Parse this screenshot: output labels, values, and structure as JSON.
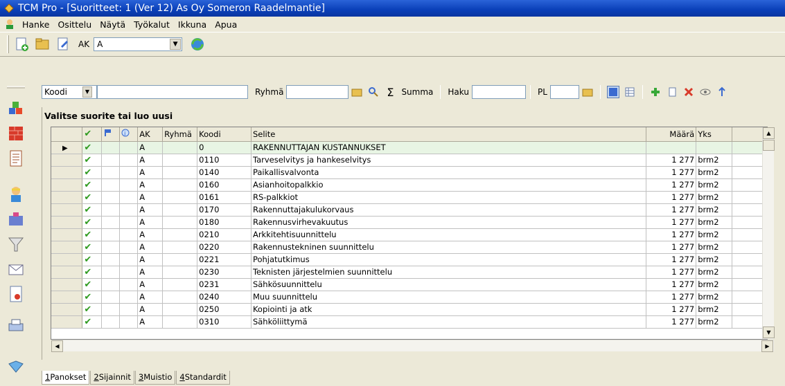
{
  "window": {
    "title": "TCM Pro - [Suoritteet: 1 (Ver 12) As Oy Someron Raadelmantie]"
  },
  "menu": [
    "Hanke",
    "Osittelu",
    "Näytä",
    "Työkalut",
    "Ikkuna",
    "Apua"
  ],
  "toolbar": {
    "ak_label": "AK",
    "ak_value": "A"
  },
  "filterbar": {
    "field_combo": "Koodi",
    "group_label": "Ryhmä",
    "sum_label": "Summa",
    "search_label": "Haku",
    "pl_label": "PL"
  },
  "panel": {
    "title": "Valitse suorite tai luo uusi"
  },
  "grid": {
    "columns": [
      "",
      "",
      "",
      "",
      "AK",
      "Ryhmä",
      "Koodi",
      "Selite",
      "Määrä",
      "Yks",
      ""
    ],
    "rows": [
      {
        "ak": "A",
        "group": "",
        "code": "0",
        "desc": "RAKENNUTTAJAN KUSTANNUKSET",
        "qty": "",
        "unit": ""
      },
      {
        "ak": "A",
        "group": "",
        "code": "0110",
        "desc": "Tarveselvitys ja hankeselvitys",
        "qty": "1 277",
        "unit": "brm2"
      },
      {
        "ak": "A",
        "group": "",
        "code": "0140",
        "desc": "Paikallisvalvonta",
        "qty": "1 277",
        "unit": "brm2"
      },
      {
        "ak": "A",
        "group": "",
        "code": "0160",
        "desc": "Asianhoitopalkkio",
        "qty": "1 277",
        "unit": "brm2"
      },
      {
        "ak": "A",
        "group": "",
        "code": "0161",
        "desc": "RS-palkkiot",
        "qty": "1 277",
        "unit": "brm2"
      },
      {
        "ak": "A",
        "group": "",
        "code": "0170",
        "desc": "Rakennuttajakulukorvaus",
        "qty": "1 277",
        "unit": "brm2"
      },
      {
        "ak": "A",
        "group": "",
        "code": "0180",
        "desc": "Rakennusvirhevakuutus",
        "qty": "1 277",
        "unit": "brm2"
      },
      {
        "ak": "A",
        "group": "",
        "code": "0210",
        "desc": "Arkkitehtisuunnittelu",
        "qty": "1 277",
        "unit": "brm2"
      },
      {
        "ak": "A",
        "group": "",
        "code": "0220",
        "desc": "Rakennustekninen suunnittelu",
        "qty": "1 277",
        "unit": "brm2"
      },
      {
        "ak": "A",
        "group": "",
        "code": "0221",
        "desc": "Pohjatutkimus",
        "qty": "1 277",
        "unit": "brm2"
      },
      {
        "ak": "A",
        "group": "",
        "code": "0230",
        "desc": "Teknisten järjestelmien suunnittelu",
        "qty": "1 277",
        "unit": "brm2"
      },
      {
        "ak": "A",
        "group": "",
        "code": "0231",
        "desc": "Sähkösuunnittelu",
        "qty": "1 277",
        "unit": "brm2"
      },
      {
        "ak": "A",
        "group": "",
        "code": "0240",
        "desc": "Muu suunnittelu",
        "qty": "1 277",
        "unit": "brm2"
      },
      {
        "ak": "A",
        "group": "",
        "code": "0250",
        "desc": "Kopiointi ja atk",
        "qty": "1 277",
        "unit": "brm2"
      },
      {
        "ak": "A",
        "group": "",
        "code": "0310",
        "desc": "Sähköliittymä",
        "qty": "1 277",
        "unit": "brm2"
      }
    ]
  },
  "tabs": [
    {
      "key": "1",
      "label": "Panokset"
    },
    {
      "key": "2",
      "label": "Sijainnit"
    },
    {
      "key": "3",
      "label": "Muistio"
    },
    {
      "key": "4",
      "label": "Standardit"
    }
  ]
}
